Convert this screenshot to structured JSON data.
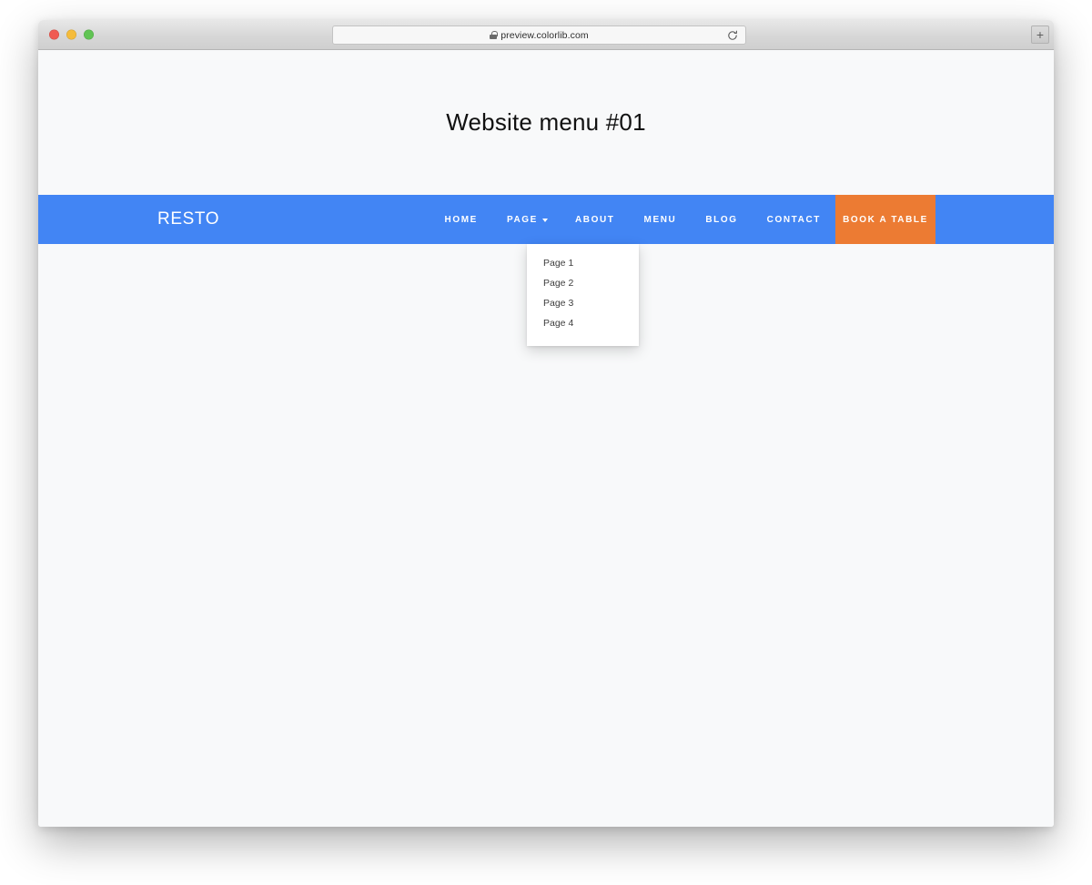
{
  "browser": {
    "url": "preview.colorlib.com",
    "lock_icon": "lock-icon",
    "reload_icon": "reload-icon",
    "new_tab_label": "+",
    "traffic_lights": [
      {
        "name": "close",
        "color": "#f05a51"
      },
      {
        "name": "minimize",
        "color": "#f5bc3c"
      },
      {
        "name": "maximize",
        "color": "#61c454"
      }
    ]
  },
  "page": {
    "hero_title": "Website menu #01",
    "background_color": "#f8f9fa"
  },
  "navbar": {
    "background_color": "#4285f4",
    "brand": "RESTO",
    "items": [
      {
        "label": "HOME",
        "has_caret": false
      },
      {
        "label": "PAGE",
        "has_caret": true,
        "caret_icon": "chevron-down-icon"
      },
      {
        "label": "ABOUT",
        "has_caret": false
      },
      {
        "label": "MENU",
        "has_caret": false
      },
      {
        "label": "BLOG",
        "has_caret": false
      },
      {
        "label": "CONTACT",
        "has_caret": false
      }
    ],
    "cta": {
      "label": "BOOK A TABLE",
      "background_color": "#ec7b33"
    }
  },
  "dropdown": {
    "open": true,
    "items": [
      {
        "label": "Page 1"
      },
      {
        "label": "Page 2"
      },
      {
        "label": "Page 3"
      },
      {
        "label": "Page 4"
      }
    ]
  }
}
